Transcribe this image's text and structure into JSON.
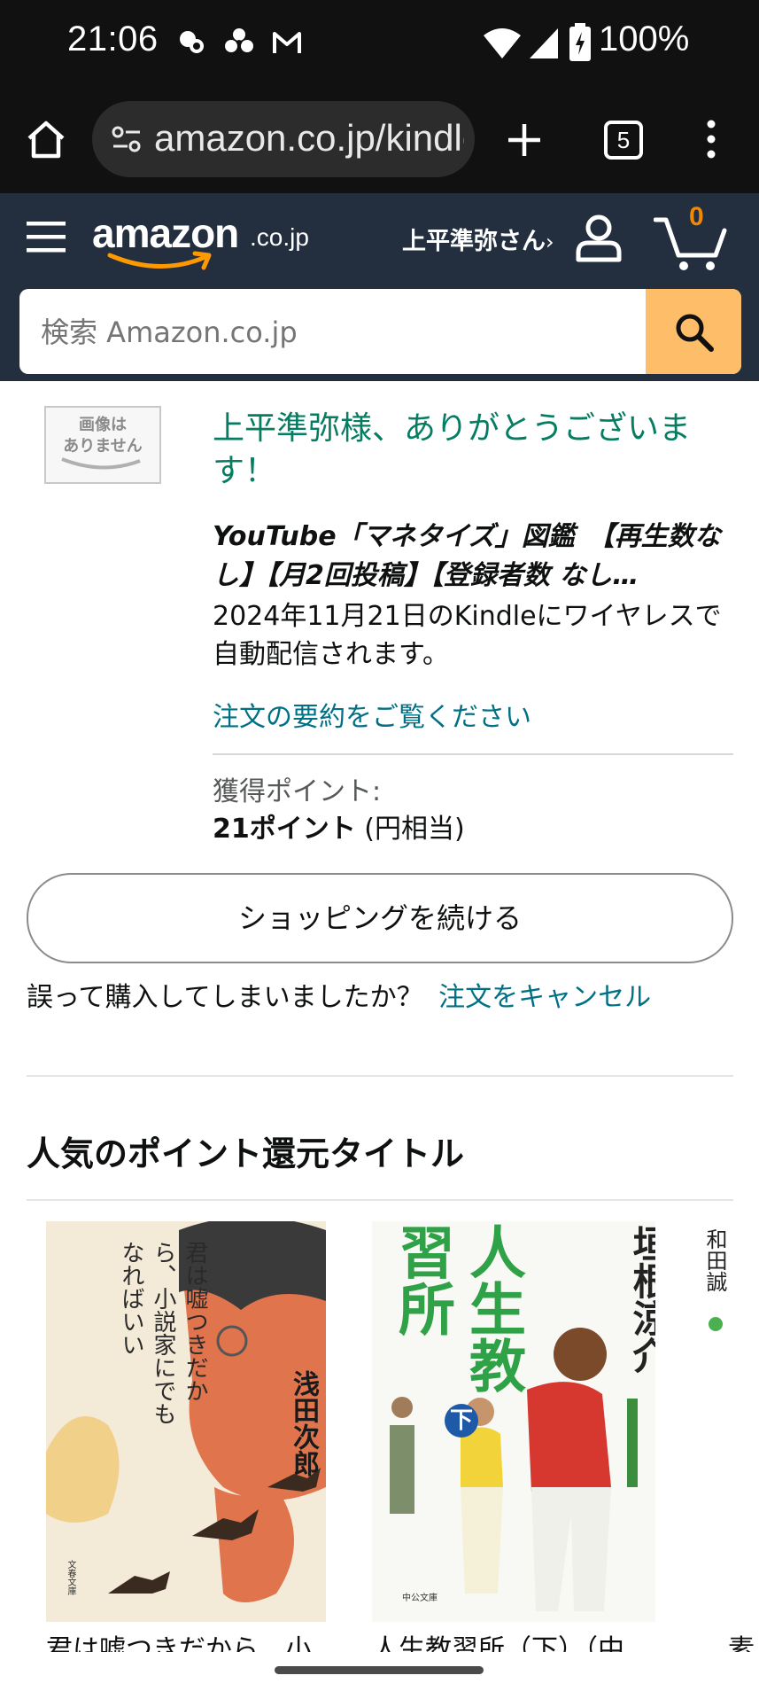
{
  "status_bar": {
    "time": "21:06",
    "battery": "100%"
  },
  "browser": {
    "url": "amazon.co.jp/kindle",
    "tab_count": "5"
  },
  "header": {
    "logo_text": "amazon",
    "logo_suffix": ".co.jp",
    "account_greeting": "上平準弥さん",
    "account_chevron": "›",
    "cart_count": "0"
  },
  "search": {
    "placeholder": "検索 Amazon.co.jp"
  },
  "confirmation": {
    "no_image_text": "画像は\nありません",
    "thanks": "上平準弥様、ありがとうございます！",
    "book_title": "YouTube「マネタイズ」図鑑　【再生数なし】【月2回投稿】【登録者数 なし…",
    "delivery": "2024年11月21日のKindleにワイヤレスで自動配信されます。",
    "order_summary_link": "注文の要約をご覧ください",
    "points_label": "獲得ポイント:",
    "points_value": "21ポイント",
    "points_suffix": "(円相当)",
    "continue_button": "ショッピングを続ける",
    "mistake_text": "誤って購入してしまいましたか？",
    "cancel_link": "注文をキャンセル"
  },
  "popular": {
    "heading": "人気のポイント還元タイトル",
    "books": [
      {
        "cover_text": "君は嘘つきだから、小説家にでもなればいい",
        "author": "浅田次郎",
        "publisher": "文春文庫",
        "caption": "君は嘘つきだから、小"
      },
      {
        "title_big": "人生教習所",
        "volume": "下",
        "author": "垣根涼介",
        "publisher": "中公文庫",
        "caption": "人生教習所（下）（中"
      },
      {
        "author": "和田誠",
        "caption": "素"
      }
    ]
  },
  "colors": {
    "header_bg": "#232f3e",
    "search_button": "#febd69",
    "success_green": "#067d62",
    "link_teal": "#007185",
    "cart_count": "#f08804"
  }
}
